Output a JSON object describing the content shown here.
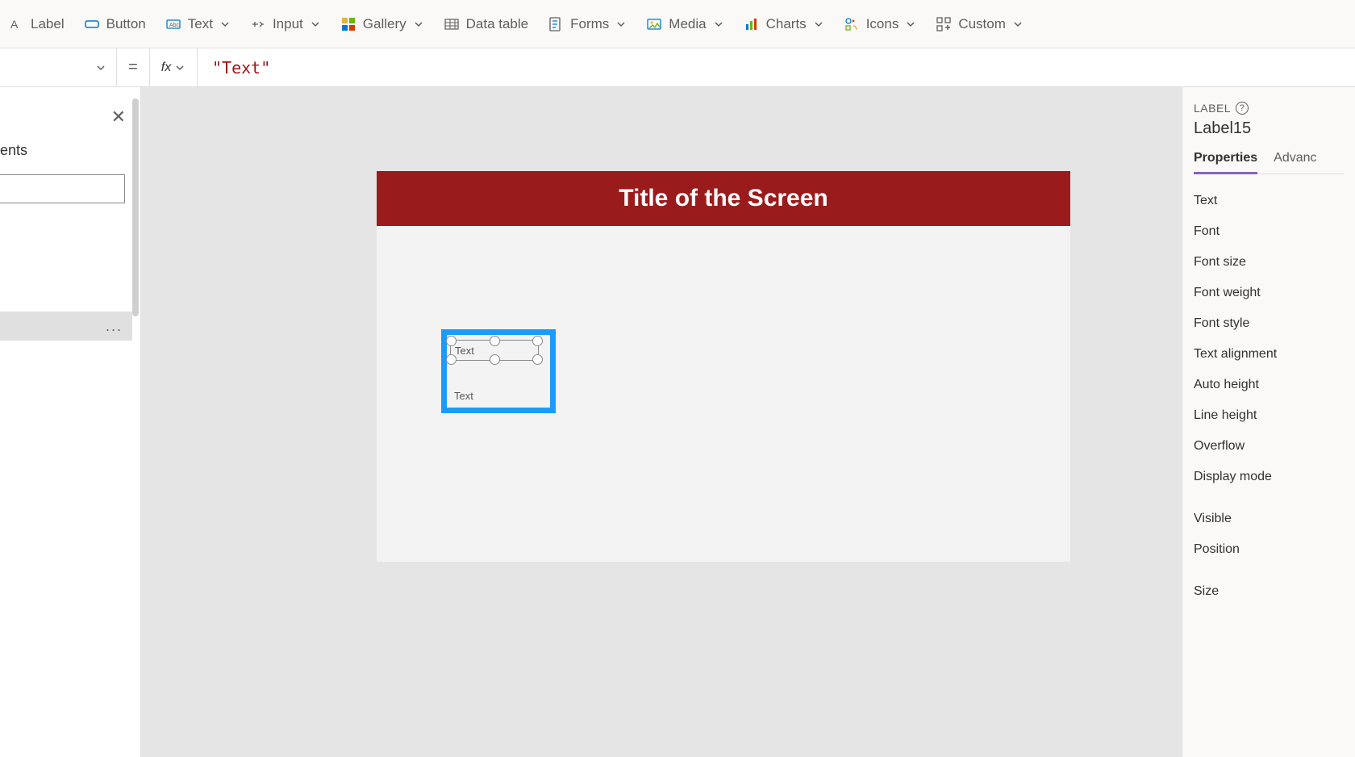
{
  "toolbar": {
    "items": [
      {
        "label": "Label",
        "icon": "label"
      },
      {
        "label": "Button",
        "icon": "button"
      },
      {
        "label": "Text",
        "icon": "text",
        "dd": true
      },
      {
        "label": "Input",
        "icon": "input",
        "dd": true
      },
      {
        "label": "Gallery",
        "icon": "gallery",
        "dd": true
      },
      {
        "label": "Data table",
        "icon": "table"
      },
      {
        "label": "Forms",
        "icon": "forms",
        "dd": true
      },
      {
        "label": "Media",
        "icon": "media",
        "dd": true
      },
      {
        "label": "Charts",
        "icon": "charts",
        "dd": true
      },
      {
        "label": "Icons",
        "icon": "icons",
        "dd": true
      },
      {
        "label": "Custom",
        "icon": "custom",
        "dd": true
      }
    ]
  },
  "formula": {
    "eq": "=",
    "fx": "fx",
    "value": "\"Text\""
  },
  "left_panel": {
    "title_fragment": "ents",
    "ellipsis": "..."
  },
  "canvas": {
    "screen_title": "Title of the Screen",
    "selected_label_text": "Text",
    "other_label_text": "Text"
  },
  "right_panel": {
    "caption": "LABEL",
    "help": "?",
    "control_name": "Label15",
    "tabs": {
      "properties": "Properties",
      "advanced": "Advanc"
    },
    "props": [
      "Text",
      "Font",
      "Font size",
      "Font weight",
      "Font style",
      "Text alignment",
      "Auto height",
      "Line height",
      "Overflow",
      "Display mode"
    ],
    "props2": [
      "Visible",
      "Position",
      "Size"
    ]
  }
}
